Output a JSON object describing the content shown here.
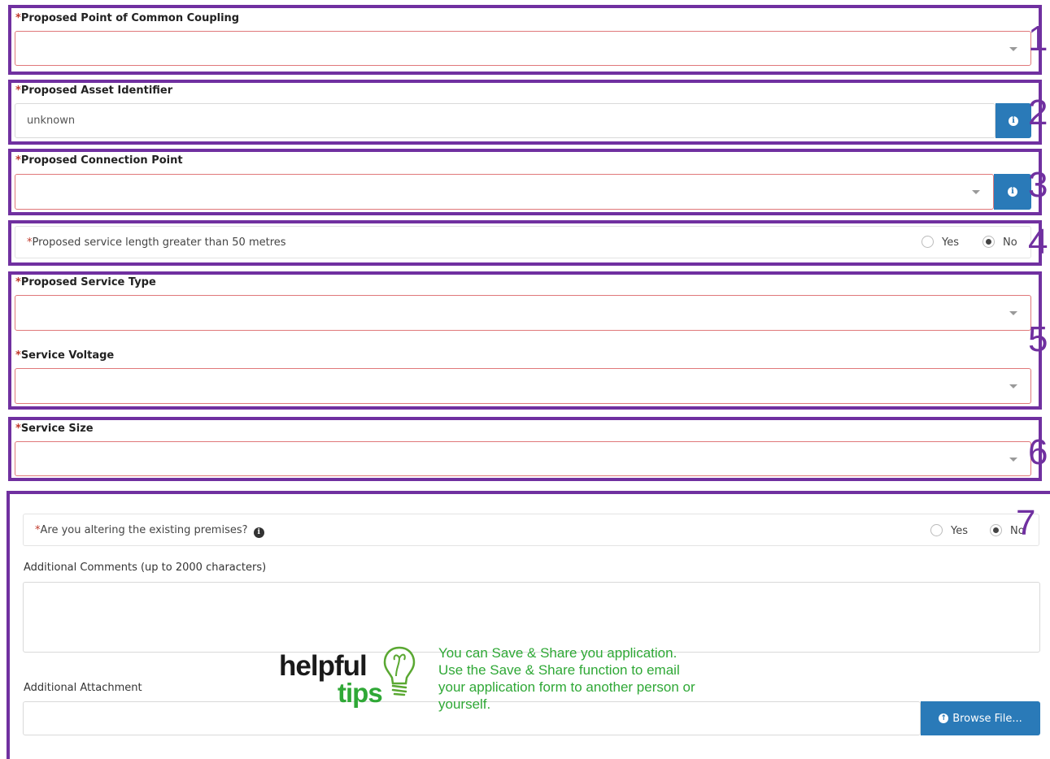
{
  "fields": {
    "pcc_label": "Proposed Point of Common Coupling",
    "asset_label": "Proposed Asset Identifier",
    "asset_value": "unknown",
    "connection_label": "Proposed Connection Point",
    "service_length_question": "Proposed service length greater than 50 metres",
    "service_type_label": "Proposed Service Type",
    "service_voltage_label": "Service Voltage",
    "service_size_label": "Service Size",
    "altering_question": "Are you altering the existing premises?",
    "comments_label": "Additional Comments (up to 2000 characters)",
    "attachment_label": "Additional Attachment",
    "browse_label": "Browse File..."
  },
  "required_marker": "*",
  "radio": {
    "yes": "Yes",
    "no": "No",
    "service_length_selected": "No",
    "altering_selected": "No"
  },
  "section_numbers": [
    "1",
    "2",
    "3",
    "4",
    "5",
    "6",
    "7"
  ],
  "helpful_tips": {
    "logo_word1": "helpful",
    "logo_word2": "tips",
    "lines": [
      "You can Save & Share you application.",
      "Use the Save & Share function to email",
      "your application form to another person or",
      "yourself."
    ]
  },
  "colors": {
    "annotation_border": "#7030a0",
    "info_button": "#2a7ab8",
    "required": "#c0392b",
    "tip_text": "#2fa836"
  }
}
